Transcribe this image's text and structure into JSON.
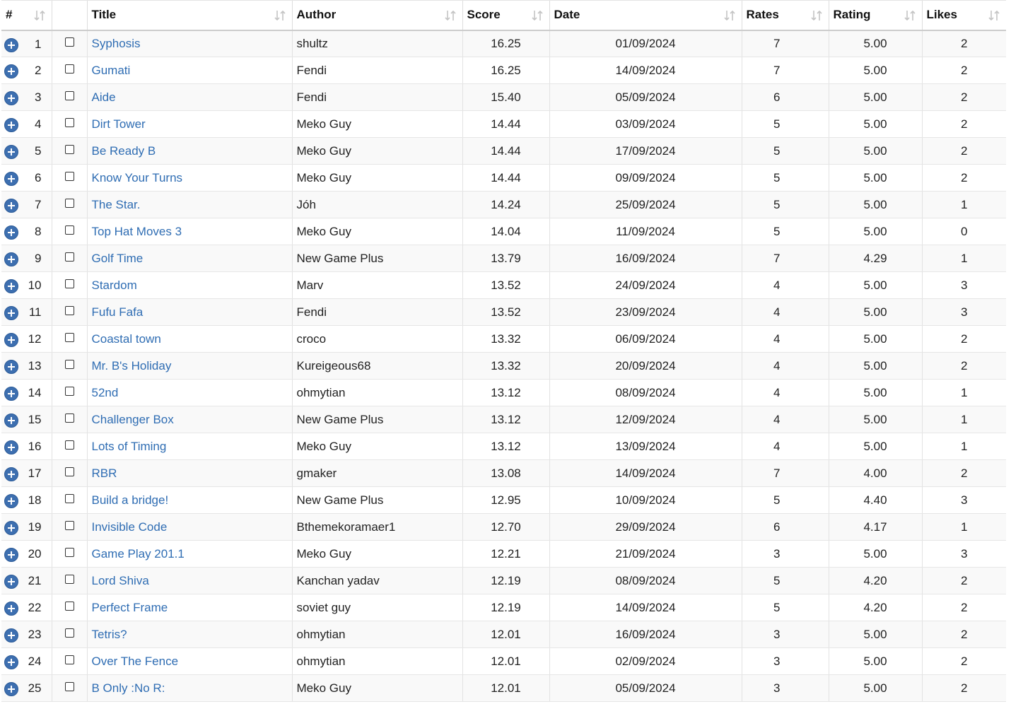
{
  "columns": [
    {
      "key": "num",
      "label": "#"
    },
    {
      "key": "chk",
      "label": ""
    },
    {
      "key": "title",
      "label": "Title"
    },
    {
      "key": "author",
      "label": "Author"
    },
    {
      "key": "score",
      "label": "Score"
    },
    {
      "key": "date",
      "label": "Date"
    },
    {
      "key": "rates",
      "label": "Rates"
    },
    {
      "key": "rating",
      "label": "Rating"
    },
    {
      "key": "likes",
      "label": "Likes"
    }
  ],
  "icons": {
    "expand": "plus-circle-icon",
    "sort": "sort-arrows-icon",
    "checkbox": "checkbox-icon"
  },
  "colors": {
    "link": "#2f6db3",
    "expander": "#3d6fb0"
  },
  "rows": [
    {
      "num": "1",
      "title": "Syphosis",
      "author": "shultz",
      "score": "16.25",
      "date": "01/09/2024",
      "rates": "7",
      "rating": "5.00",
      "likes": "2"
    },
    {
      "num": "2",
      "title": "Gumati",
      "author": "Fendi",
      "score": "16.25",
      "date": "14/09/2024",
      "rates": "7",
      "rating": "5.00",
      "likes": "2"
    },
    {
      "num": "3",
      "title": "Aide",
      "author": "Fendi",
      "score": "15.40",
      "date": "05/09/2024",
      "rates": "6",
      "rating": "5.00",
      "likes": "2"
    },
    {
      "num": "4",
      "title": "Dirt Tower",
      "author": "Meko Guy",
      "score": "14.44",
      "date": "03/09/2024",
      "rates": "5",
      "rating": "5.00",
      "likes": "2"
    },
    {
      "num": "5",
      "title": "Be Ready B",
      "author": "Meko Guy",
      "score": "14.44",
      "date": "17/09/2024",
      "rates": "5",
      "rating": "5.00",
      "likes": "2"
    },
    {
      "num": "6",
      "title": "Know Your Turns",
      "author": "Meko Guy",
      "score": "14.44",
      "date": "09/09/2024",
      "rates": "5",
      "rating": "5.00",
      "likes": "2"
    },
    {
      "num": "7",
      "title": "The Star.",
      "author": "Jóh",
      "score": "14.24",
      "date": "25/09/2024",
      "rates": "5",
      "rating": "5.00",
      "likes": "1"
    },
    {
      "num": "8",
      "title": "Top Hat Moves 3",
      "author": "Meko Guy",
      "score": "14.04",
      "date": "11/09/2024",
      "rates": "5",
      "rating": "5.00",
      "likes": "0"
    },
    {
      "num": "9",
      "title": "Golf Time",
      "author": "New Game Plus",
      "score": "13.79",
      "date": "16/09/2024",
      "rates": "7",
      "rating": "4.29",
      "likes": "1"
    },
    {
      "num": "10",
      "title": "Stardom",
      "author": "Marv",
      "score": "13.52",
      "date": "24/09/2024",
      "rates": "4",
      "rating": "5.00",
      "likes": "3"
    },
    {
      "num": "11",
      "title": "Fufu Fafa",
      "author": "Fendi",
      "score": "13.52",
      "date": "23/09/2024",
      "rates": "4",
      "rating": "5.00",
      "likes": "3"
    },
    {
      "num": "12",
      "title": "Coastal town",
      "author": "croco",
      "score": "13.32",
      "date": "06/09/2024",
      "rates": "4",
      "rating": "5.00",
      "likes": "2"
    },
    {
      "num": "13",
      "title": "Mr. B's Holiday",
      "author": "Kureigeous68",
      "score": "13.32",
      "date": "20/09/2024",
      "rates": "4",
      "rating": "5.00",
      "likes": "2"
    },
    {
      "num": "14",
      "title": "52nd",
      "author": "ohmytian",
      "score": "13.12",
      "date": "08/09/2024",
      "rates": "4",
      "rating": "5.00",
      "likes": "1"
    },
    {
      "num": "15",
      "title": "Challenger Box",
      "author": "New Game Plus",
      "score": "13.12",
      "date": "12/09/2024",
      "rates": "4",
      "rating": "5.00",
      "likes": "1"
    },
    {
      "num": "16",
      "title": "Lots of Timing",
      "author": "Meko Guy",
      "score": "13.12",
      "date": "13/09/2024",
      "rates": "4",
      "rating": "5.00",
      "likes": "1"
    },
    {
      "num": "17",
      "title": "RBR",
      "author": "gmaker",
      "score": "13.08",
      "date": "14/09/2024",
      "rates": "7",
      "rating": "4.00",
      "likes": "2"
    },
    {
      "num": "18",
      "title": "Build a bridge!",
      "author": "New Game Plus",
      "score": "12.95",
      "date": "10/09/2024",
      "rates": "5",
      "rating": "4.40",
      "likes": "3"
    },
    {
      "num": "19",
      "title": "Invisible Code",
      "author": "Bthemekoramaer1",
      "score": "12.70",
      "date": "29/09/2024",
      "rates": "6",
      "rating": "4.17",
      "likes": "1"
    },
    {
      "num": "20",
      "title": "Game Play 201.1",
      "author": "Meko Guy",
      "score": "12.21",
      "date": "21/09/2024",
      "rates": "3",
      "rating": "5.00",
      "likes": "3"
    },
    {
      "num": "21",
      "title": "Lord Shiva",
      "author": "Kanchan yadav",
      "score": "12.19",
      "date": "08/09/2024",
      "rates": "5",
      "rating": "4.20",
      "likes": "2"
    },
    {
      "num": "22",
      "title": "Perfect Frame",
      "author": "soviet guy",
      "score": "12.19",
      "date": "14/09/2024",
      "rates": "5",
      "rating": "4.20",
      "likes": "2"
    },
    {
      "num": "23",
      "title": "Tetris?",
      "author": "ohmytian",
      "score": "12.01",
      "date": "16/09/2024",
      "rates": "3",
      "rating": "5.00",
      "likes": "2"
    },
    {
      "num": "24",
      "title": "Over The Fence",
      "author": "ohmytian",
      "score": "12.01",
      "date": "02/09/2024",
      "rates": "3",
      "rating": "5.00",
      "likes": "2"
    },
    {
      "num": "25",
      "title": "B Only :No R:",
      "author": "Meko Guy",
      "score": "12.01",
      "date": "05/09/2024",
      "rates": "3",
      "rating": "5.00",
      "likes": "2"
    }
  ]
}
